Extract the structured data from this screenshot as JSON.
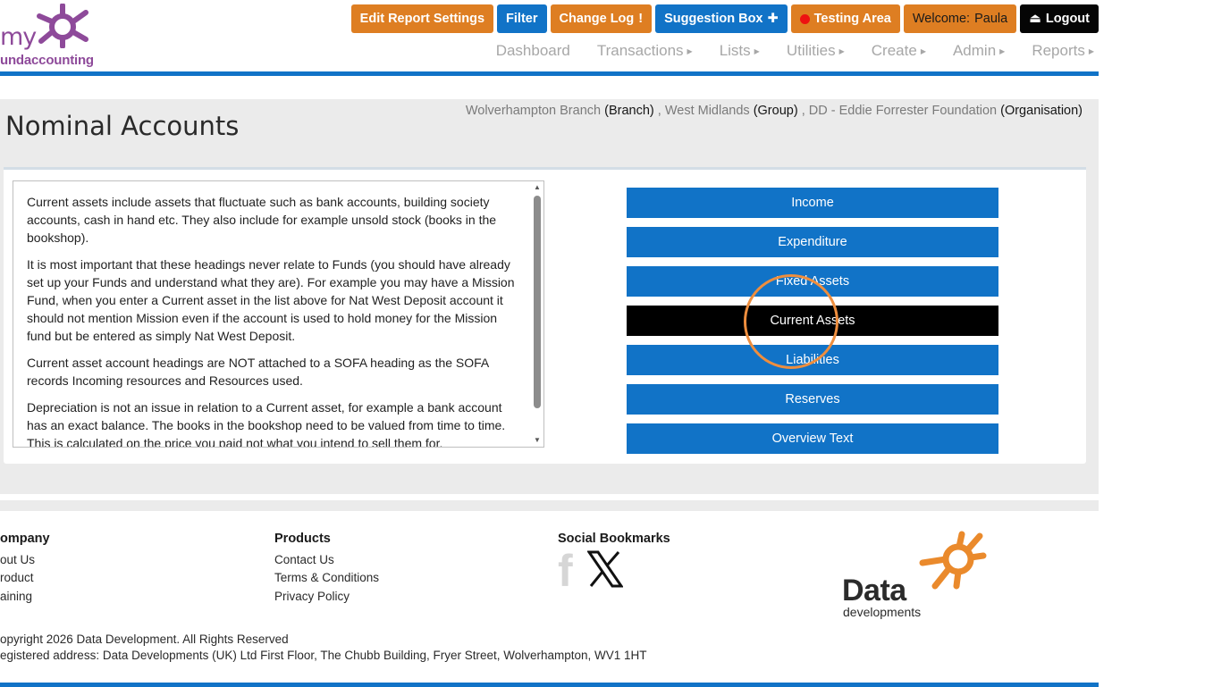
{
  "logo": {
    "line1": "my",
    "line2": "undaccounting",
    "icon": "fund-star-logo"
  },
  "topbar": {
    "edit_report_settings": "Edit Report Settings",
    "filter": "Filter",
    "change_log": "Change Log",
    "change_log_icon": "!",
    "suggestion_box": "Suggestion Box",
    "suggestion_icon": "✚",
    "testing_area": "Testing Area",
    "welcome_label": "Welcome:",
    "welcome_user": "Paula",
    "logout": "Logout",
    "logout_icon": "⏏"
  },
  "nav": [
    {
      "label": "Dashboard",
      "has_caret": false
    },
    {
      "label": "Transactions",
      "has_caret": true
    },
    {
      "label": "Lists",
      "has_caret": true
    },
    {
      "label": "Utilities",
      "has_caret": true
    },
    {
      "label": "Create",
      "has_caret": true
    },
    {
      "label": "Admin",
      "has_caret": true
    },
    {
      "label": "Reports",
      "has_caret": true
    }
  ],
  "page": {
    "title": "Nominal Accounts",
    "org": {
      "branch": "Wolverhampton Branch",
      "branch_tag": "(Branch)",
      "sep1": ",",
      "group": "West Midlands",
      "group_tag": "(Group)",
      "sep2": ",",
      "organisation": "DD - Eddie Forrester Foundation",
      "organisation_tag": "(Organisation)"
    }
  },
  "help_text": {
    "paragraphs": [
      "Current assets include assets that fluctuate such as bank accounts, building society accounts, cash in hand etc. They also include for example unsold stock (books in the bookshop).",
      "It is most important that these headings never relate to Funds (you should have already set up your Funds and understand what they are). For example you may have a Mission Fund, when you enter a Current asset in the list above for Nat West Deposit account it should not mention Mission even if the account is used to hold money for the Mission fund but be entered as simply Nat West Deposit.",
      "Current asset account headings are NOT attached to a SOFA heading as the SOFA records Incoming resources and Resources used.",
      "Depreciation is not an issue in relation to a Current asset, for example a bank account has an exact balance. The books in the bookshop need to be valued from time to time. This is calculated on the price you paid not what you intend to sell them for."
    ],
    "scroll_up": "▲",
    "scroll_down": "▼"
  },
  "categories": [
    {
      "label": "Income",
      "active": false
    },
    {
      "label": "Expenditure",
      "active": false
    },
    {
      "label": "Fixed Assets",
      "active": false
    },
    {
      "label": "Current Assets",
      "active": true
    },
    {
      "label": "Liabilities",
      "active": false
    },
    {
      "label": "Reserves",
      "active": false
    },
    {
      "label": "Overview Text",
      "active": false
    }
  ],
  "footer": {
    "company": {
      "heading": "ompany",
      "links": [
        "out Us",
        "roduct",
        "aining"
      ]
    },
    "products": {
      "heading": "Products",
      "links": [
        "Contact Us",
        "Terms & Conditions",
        "Privacy Policy"
      ]
    },
    "social": {
      "heading": "Social Bookmarks",
      "facebook_glyph": "f",
      "x_icon": "x-logo-icon"
    },
    "brand": {
      "line1": "Data",
      "line2": "developments"
    },
    "copyright": "opyright 2026 Data Development. All Rights Reserved",
    "address": "egistered address: Data Developments (UK) Ltd First Floor, The Chubb Building, Fryer Street, Wolverhampton, WV1 1HT"
  },
  "colors": {
    "brand_blue": "#1173c7",
    "brand_orange": "#de7e22",
    "logo_purple": "#8e4a9a",
    "active_button": "#000000",
    "highlight_ring": "#ee8e3e"
  }
}
